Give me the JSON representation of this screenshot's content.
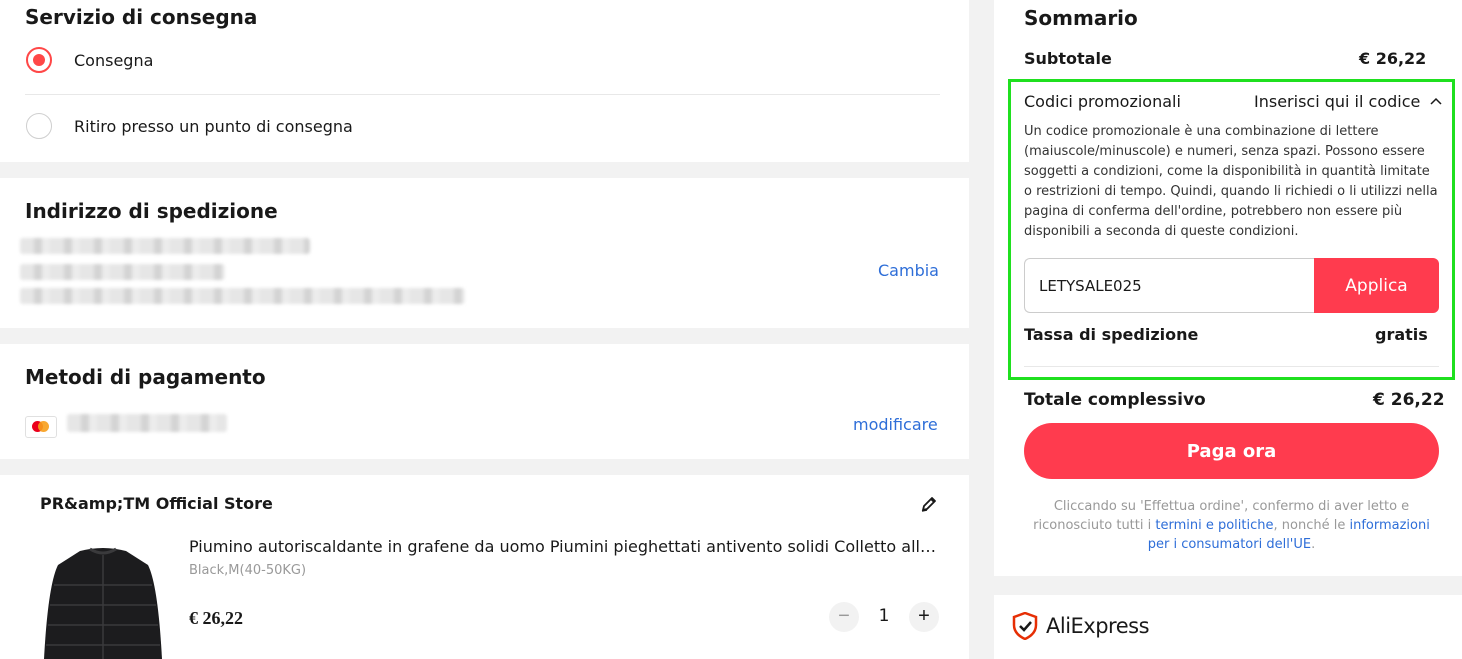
{
  "delivery": {
    "title": "Servizio di consegna",
    "options": [
      {
        "label": "Consegna",
        "selected": true
      },
      {
        "label": "Ritiro presso un punto di consegna",
        "selected": false
      }
    ]
  },
  "address": {
    "title": "Indirizzo di spedizione",
    "change_label": "Cambia"
  },
  "payment": {
    "title": "Metodi di pagamento",
    "card_icon": "mastercard-icon",
    "change_label": "modificare"
  },
  "product": {
    "store": "PR&amp;TM Official Store",
    "title": "Piumino autoriscaldante in grafene da uomo Piumini pieghettati antivento solidi Colletto alla coreana",
    "variant": "Black,M(40-50KG)",
    "price": "€ 26,22",
    "quantity": "1",
    "minus": "−",
    "plus": "+"
  },
  "summary": {
    "title": "Sommario",
    "subtotal_label": "Subtotale",
    "subtotal_value": "€ 26,22",
    "promo_label": "Codici promozionali",
    "promo_toggle": "Inserisci qui il codice",
    "promo_desc": "Un codice promozionale è una combinazione di lettere (maiuscole/minuscole) e numeri, senza spazi. Possono essere soggetti a condizioni, come la disponibilità in quantità limitate o restrizioni di tempo. Quindi, quando li richiedi o li utilizzi nella pagina di conferma dell'ordine, potrebbero non essere più disponibili a seconda di queste condizioni.",
    "promo_code": "LETYSALE025",
    "apply_label": "Applica",
    "shipping_label": "Tassa di spedizione",
    "shipping_value": "gratis",
    "total_label": "Totale complessivo",
    "total_value": "€ 26,22",
    "pay_label": "Paga ora",
    "legal_pre": "Cliccando su 'Effettua ordine', confermo di aver letto e riconosciuto tutti i ",
    "legal_link1": "termini e politiche",
    "legal_mid": ", nonché le ",
    "legal_link2": "informazioni per i consumatori dell'UE",
    "legal_post": "."
  },
  "brand": {
    "name": "AliExpress"
  },
  "colors": {
    "accent": "#ff3b4e",
    "radio": "#ff4747",
    "link": "#2e6ed8",
    "highlight": "#1fe01f"
  }
}
